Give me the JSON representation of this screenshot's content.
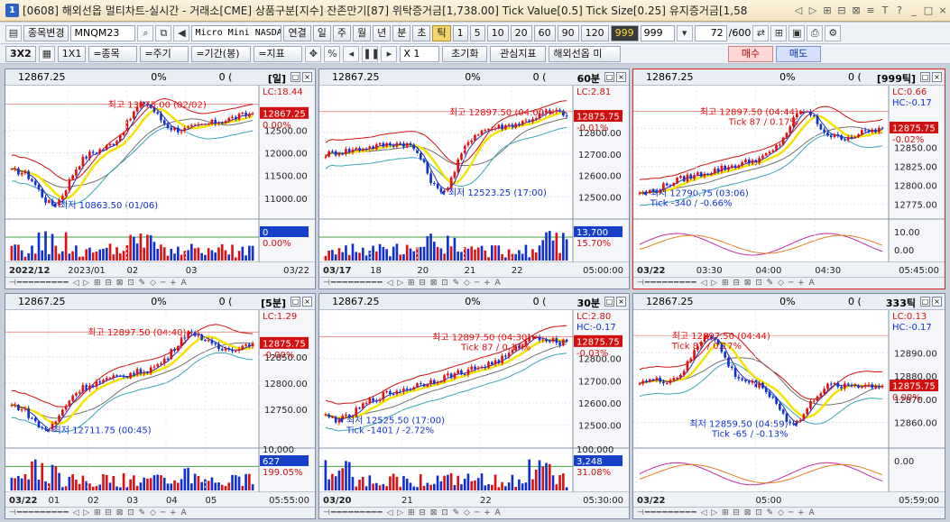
{
  "window": {
    "number": "1",
    "title": "[0608] 해외선옵 멀티차트-실시간 - 거래소[CME] 상품구분[지수] 잔존만기[87] 위탁증거금[1,738.00] Tick Value[0.5] Tick Size[0.25] 유지증거금[1,58",
    "buttons": [
      "◁",
      "▷",
      "⊞",
      "⊟",
      "⊠",
      "≡",
      "T",
      "?",
      "_",
      "□",
      "×"
    ]
  },
  "toolbar1": {
    "change_label": "종목변경",
    "symbol": "MNQM23",
    "product_name": "Micro Mini NASDAQ",
    "link_label": "연결",
    "periods": [
      "일",
      "주",
      "월",
      "년",
      "분",
      "초",
      "틱"
    ],
    "selected_period": "틱",
    "intervals": [
      "1",
      "5",
      "10",
      "20",
      "60",
      "90",
      "120",
      "999"
    ],
    "selected_interval": "999",
    "interval_value": "999",
    "count_value": "72",
    "count_total": "/600",
    "checkbox_value": "0"
  },
  "toolbar2": {
    "layout_label": "3X2",
    "one_by_one": "1X1",
    "item_label": "=종목",
    "cycle_label": "=주기",
    "period_label": "=기간(봉)",
    "indicator_label": "=지표",
    "zoom_label": "X 1",
    "reset_label": "초기화",
    "interest_label": "관심지표",
    "overseas_label": "해외선옵 미",
    "buy_label": "매수",
    "sell_label": "매도"
  },
  "colors": {
    "up": "#e01010",
    "down": "#1030d0",
    "ma_yellow": "#f4e400",
    "ma_teal": "#3aa7b5",
    "ma_grey": "#707070",
    "band": "#d01010",
    "price_box": "#d01010",
    "vol_box": "#1640c8"
  },
  "panels": [
    {
      "id": "daily",
      "price": "12867.25",
      "pct": "0%",
      "vol": "0 (",
      "type": "[일]",
      "high_label": "최고 13075.00 (02/02)",
      "low_label": "최저 10863.50 (01/06)",
      "lc": "LC:18.44",
      "current": "12867.25",
      "current_pct": "0.00%",
      "price_ticks": [
        "12500.00",
        "12000.00",
        "11500.00",
        "11000.00"
      ],
      "vol_box": "0",
      "vol_pct": "0.00%",
      "time_ticks": [
        "2022/12",
        "2023/01",
        "02",
        "03"
      ],
      "time_end": "03/22",
      "chart_data": {
        "type": "candlestick",
        "ylim": [
          10700,
          13200
        ],
        "start": 11600,
        "end": 12867.25,
        "high": 13075,
        "low": 10863.5,
        "high_at": 0.55,
        "low_at": 0.17
      }
    },
    {
      "id": "60min",
      "price": "12867.25",
      "pct": "0%",
      "vol": "0 (",
      "type": "60분",
      "high_label": "최고 12897.50 (04:00)",
      "low_label": "최저 12523.25 (17:00)",
      "lc": "LC:2.81",
      "current": "12875.75",
      "current_pct": "-0.01%",
      "price_ticks": [
        "12800.00",
        "12700.00",
        "12600.00",
        "12500.00"
      ],
      "vol_box": "13,700",
      "vol_pct": "15.70%",
      "time_ticks": [
        "03/17",
        "18",
        "20",
        "21",
        "22"
      ],
      "time_end": "05:00:00",
      "chart_data": {
        "type": "candlestick",
        "ylim": [
          12430,
          12960
        ],
        "start": 12700,
        "end": 12875.75,
        "high": 12897.5,
        "low": 12523.25,
        "high_at": 0.95,
        "low_at": 0.48
      }
    },
    {
      "id": "999tick",
      "price": "12867.25",
      "pct": "0%",
      "vol": "0 (",
      "type": "[999틱]",
      "high_label": "최고 12897.50 (04:44)",
      "high_sub": "Tick 87 / 0.17%",
      "low_label": "최저 12790.75 (03:06)",
      "low_sub": "Tick -340 / -0.66%",
      "lc": "LC:0.66",
      "hc": "HC:-0.17",
      "current": "12875.75",
      "current_pct": "-0.02%",
      "price_ticks": [
        "12875.00",
        "12850.00",
        "12825.00",
        "12800.00",
        "12775.00"
      ],
      "ind_ticks": [
        "10.00",
        "0.00"
      ],
      "time_ticks": [
        "03/22",
        "03:30",
        "04:00",
        "04:30"
      ],
      "time_end": "05:45:00",
      "chart_data": {
        "type": "candlestick",
        "ylim": [
          12765,
          12915
        ],
        "start": 12795,
        "end": 12875.75,
        "high": 12897.5,
        "low": 12790.75,
        "high_at": 0.68,
        "low_at": 0.02
      }
    },
    {
      "id": "5min",
      "price": "12867.25",
      "pct": "0%",
      "vol": "0 (",
      "type": "[5분]",
      "high_label": "최고 12897.50 (04:40)",
      "low_label": "최저 12711.75 (00:45)",
      "lc": "LC:1.29",
      "current": "12875.75",
      "current_pct": "-0.00%",
      "price_ticks": [
        "12850.00",
        "12800.00",
        "12750.00"
      ],
      "vol_box": "627",
      "vol_pct": "199.05%",
      "vol_tick": "10,000",
      "time_ticks": [
        "03/22",
        "01",
        "02",
        "03",
        "04",
        "05"
      ],
      "time_end": "05:55:00",
      "chart_data": {
        "type": "candlestick",
        "ylim": [
          12690,
          12915
        ],
        "start": 12760,
        "end": 12875.75,
        "high": 12897.5,
        "low": 12711.75,
        "high_at": 0.74,
        "low_at": 0.14
      }
    },
    {
      "id": "30min",
      "price": "12867.25",
      "pct": "0%",
      "vol": "0 (",
      "type": "30분",
      "high_label": "최고 12897.50 (04:30)",
      "high_sub": "Tick 87 / 0.17%",
      "low_label": "최저 12525.50 (17:00)",
      "low_sub": "Tick -1401 / -2.72%",
      "lc": "LC:2.80",
      "hc": "HC:-0.17",
      "current": "12875.75",
      "current_pct": "-0.03%",
      "price_ticks": [
        "12800.00",
        "12700.00",
        "12600.00",
        "12500.00"
      ],
      "vol_box": "3,248",
      "vol_pct": "31.08%",
      "vol_tick": "100,000",
      "time_ticks": [
        "03/20",
        "21",
        "22"
      ],
      "time_end": "05:30:00",
      "chart_data": {
        "type": "candlestick",
        "ylim": [
          12430,
          12960
        ],
        "start": 12560,
        "end": 12875.75,
        "high": 12897.5,
        "low": 12525.5,
        "high_at": 0.88,
        "low_at": 0.06
      }
    },
    {
      "id": "333tick",
      "price": "12867.25",
      "pct": "0%",
      "vol": "0 (",
      "type": "333틱",
      "high_label": "최고 12897.50 (04:44)",
      "high_sub": "Tick 87 / 0.17%",
      "low_label": "최저 12859.50 (04:59)",
      "low_sub": "Tick -65 / -0.13%",
      "lc": "LC:0.13",
      "hc": "HC:-0.17",
      "current": "12875.75",
      "current_pct": "0.00%",
      "price_ticks": [
        "12890.00",
        "12880.00",
        "12870.00",
        "12860.00"
      ],
      "ind_ticks": [
        "0.00"
      ],
      "time_ticks": [
        "03/22",
        "05:00"
      ],
      "time_end": "05:59:00",
      "chart_data": {
        "type": "candlestick",
        "ylim": [
          12852,
          12903
        ],
        "start": 12878,
        "end": 12875.75,
        "high": 12897.5,
        "low": 12859.5,
        "high_at": 0.28,
        "low_at": 0.63
      }
    }
  ],
  "footer_controls": "⊣━━━━━━━━━ ◁ ▷ ⊞ ⊟ ⊠ ⊡ ✎ ◇ ─ + A"
}
